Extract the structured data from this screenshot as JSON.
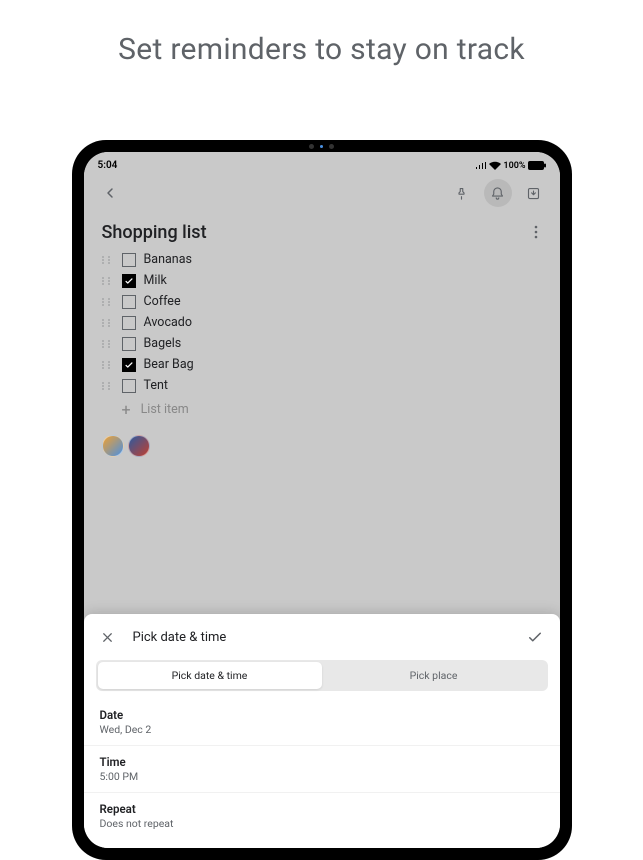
{
  "promo": {
    "title": "Set reminders to stay on track"
  },
  "status": {
    "time": "5:04",
    "battery": "100%"
  },
  "note": {
    "title": "Shopping list",
    "add_placeholder": "List item"
  },
  "items": [
    {
      "label": "Bananas",
      "checked": false
    },
    {
      "label": "Milk",
      "checked": true
    },
    {
      "label": "Coffee",
      "checked": false
    },
    {
      "label": "Avocado",
      "checked": false
    },
    {
      "label": "Bagels",
      "checked": false
    },
    {
      "label": "Bear Bag",
      "checked": true
    },
    {
      "label": "Tent",
      "checked": false
    }
  ],
  "sheet": {
    "title": "Pick date & time",
    "tabs": {
      "date_time": "Pick date & time",
      "place": "Pick place"
    },
    "date": {
      "label": "Date",
      "value": "Wed, Dec 2"
    },
    "time": {
      "label": "Time",
      "value": "5:00 PM"
    },
    "repeat": {
      "label": "Repeat",
      "value": "Does not repeat"
    }
  }
}
